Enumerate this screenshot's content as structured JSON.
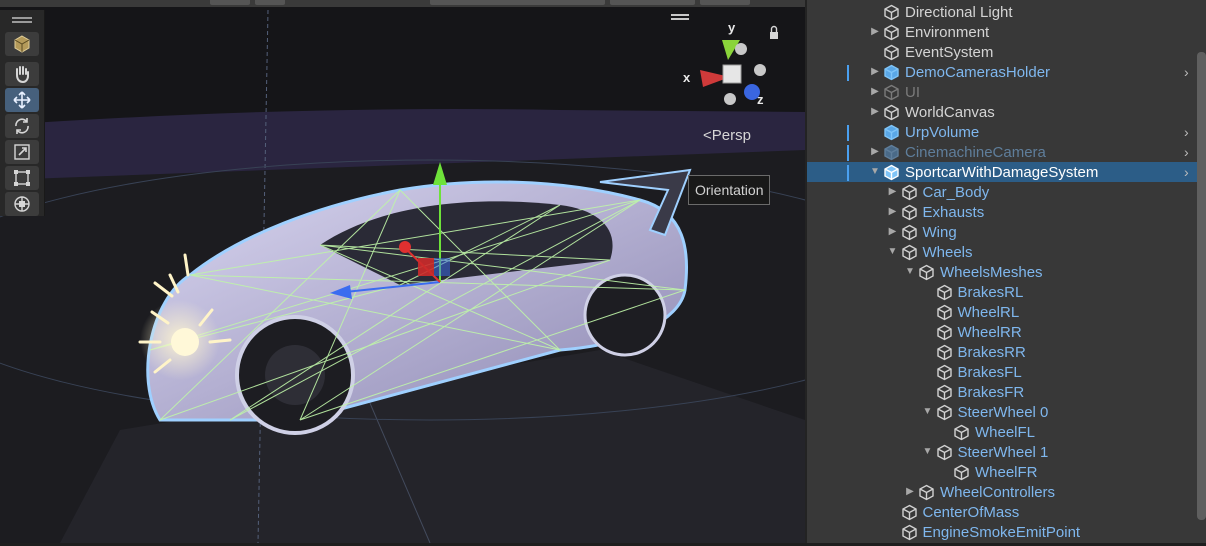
{
  "scene": {
    "persp_label": "Persp",
    "tooltip": "Orientation",
    "axis_labels": {
      "x": "x",
      "y": "y",
      "z": "z"
    },
    "tools": [
      {
        "name": "view-mode-icon"
      },
      {
        "name": "hand-tool-icon"
      },
      {
        "name": "move-tool-icon",
        "active": true
      },
      {
        "name": "rotate-tool-icon"
      },
      {
        "name": "scale-tool-icon"
      },
      {
        "name": "rect-tool-icon"
      },
      {
        "name": "transform-tool-icon"
      }
    ]
  },
  "hierarchy": {
    "items": [
      {
        "label": "Directional Light",
        "level": 0,
        "expand": "none",
        "style": "normal"
      },
      {
        "label": "Environment",
        "level": 0,
        "expand": "collapsed",
        "style": "normal"
      },
      {
        "label": "EventSystem",
        "level": 0,
        "expand": "none",
        "style": "normal"
      },
      {
        "label": "DemoCamerasHolder",
        "level": 0,
        "expand": "collapsed",
        "style": "prefab",
        "chevron": true,
        "prefab_bar": true
      },
      {
        "label": "UI",
        "level": 0,
        "expand": "collapsed",
        "style": "inactive"
      },
      {
        "label": "WorldCanvas",
        "level": 0,
        "expand": "collapsed",
        "style": "normal"
      },
      {
        "label": "UrpVolume",
        "level": 0,
        "expand": "none",
        "style": "prefab",
        "chevron": true,
        "prefab_bar": true
      },
      {
        "label": "CinemachineCamera",
        "level": 0,
        "expand": "collapsed",
        "style": "inactive-prefab",
        "chevron": true,
        "prefab_bar": true
      },
      {
        "label": "SportcarWithDamageSystem",
        "level": 0,
        "expand": "expanded",
        "style": "selected",
        "chevron": true,
        "prefab_bar": true
      },
      {
        "label": "Car_Body",
        "level": 1,
        "expand": "collapsed",
        "style": "prefab"
      },
      {
        "label": "Exhausts",
        "level": 1,
        "expand": "collapsed",
        "style": "prefab"
      },
      {
        "label": "Wing",
        "level": 1,
        "expand": "collapsed",
        "style": "prefab"
      },
      {
        "label": "Wheels",
        "level": 1,
        "expand": "expanded",
        "style": "prefab"
      },
      {
        "label": "WheelsMeshes",
        "level": 2,
        "expand": "expanded",
        "style": "prefab"
      },
      {
        "label": "BrakesRL",
        "level": 3,
        "expand": "none",
        "style": "prefab"
      },
      {
        "label": "WheelRL",
        "level": 3,
        "expand": "none",
        "style": "prefab"
      },
      {
        "label": "WheelRR",
        "level": 3,
        "expand": "none",
        "style": "prefab"
      },
      {
        "label": "BrakesRR",
        "level": 3,
        "expand": "none",
        "style": "prefab"
      },
      {
        "label": "BrakesFL",
        "level": 3,
        "expand": "none",
        "style": "prefab"
      },
      {
        "label": "BrakesFR",
        "level": 3,
        "expand": "none",
        "style": "prefab"
      },
      {
        "label": "SteerWheel 0",
        "level": 3,
        "expand": "expanded",
        "style": "prefab"
      },
      {
        "label": "WheelFL",
        "level": 4,
        "expand": "none",
        "style": "prefab"
      },
      {
        "label": "SteerWheel 1",
        "level": 3,
        "expand": "expanded",
        "style": "prefab"
      },
      {
        "label": "WheelFR",
        "level": 4,
        "expand": "none",
        "style": "prefab"
      },
      {
        "label": "WheelControllers",
        "level": 2,
        "expand": "collapsed",
        "style": "prefab"
      },
      {
        "label": "CenterOfMass",
        "level": 1,
        "expand": "none",
        "style": "prefab"
      },
      {
        "label": "EngineSmokeEmitPoint",
        "level": 1,
        "expand": "none",
        "style": "prefab"
      }
    ]
  }
}
